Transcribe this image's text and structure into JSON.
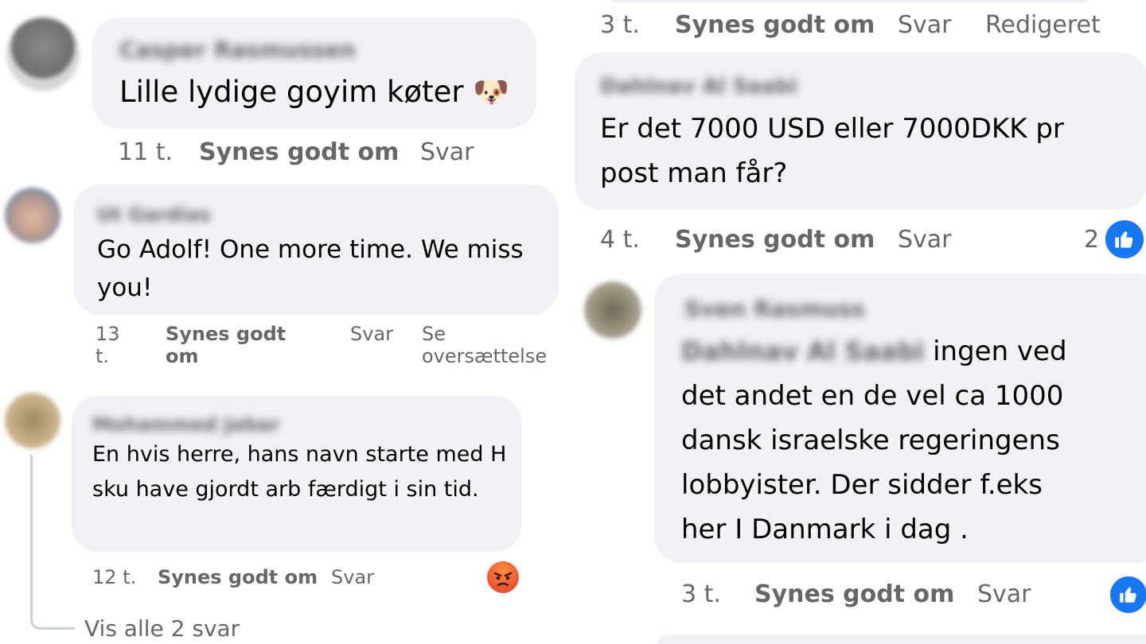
{
  "comments": [
    {
      "author": "Casper Rasmussen",
      "text": "Lille lydige goyim køter 🐶",
      "time": "11 t.",
      "like_label": "Synes godt om",
      "reply_label": "Svar"
    },
    {
      "author": "Ut Gardias",
      "text": "Go Adolf! One more time. We miss you!",
      "time": "13 t.",
      "like_label": "Synes godt om",
      "reply_label": "Svar",
      "translate_label": "Se oversættelse"
    },
    {
      "author": "Mohammed Jabar",
      "text": "En hvis herre, hans navn starte med H sku have gjordt arb færdigt i sin tid.",
      "time": "12 t.",
      "like_label": "Synes godt om",
      "reply_label": "Svar",
      "reaction": "angry-face-icon",
      "view_replies": "Vis alle 2 svar"
    },
    {
      "time": "3 t.",
      "like_label": "Synes godt om",
      "reply_label": "Svar",
      "edited_label": "Redigeret"
    },
    {
      "author": "Dahlnav Al Saabi",
      "text": "Er det 7000 USD eller 7000DKK pr post man får?",
      "time": "4 t.",
      "like_label": "Synes godt om",
      "reply_label": "Svar",
      "like_count": "2"
    },
    {
      "author": "Sven Rasmuss",
      "mention": "Dahlnav Al Saabi",
      "text_lines": [
        "ingen ved",
        "det andet en de vel ca 1000",
        "dansk israelske regeringens",
        "lobbyister. Der sidder f.eks",
        "her I Danmark i dag ."
      ],
      "time": "3 t.",
      "like_label": "Synes godt om",
      "reply_label": "Svar"
    }
  ],
  "colors": {
    "bubble": "#f0f2f5",
    "meta": "#65676b",
    "like_blue": "#1877f2"
  }
}
